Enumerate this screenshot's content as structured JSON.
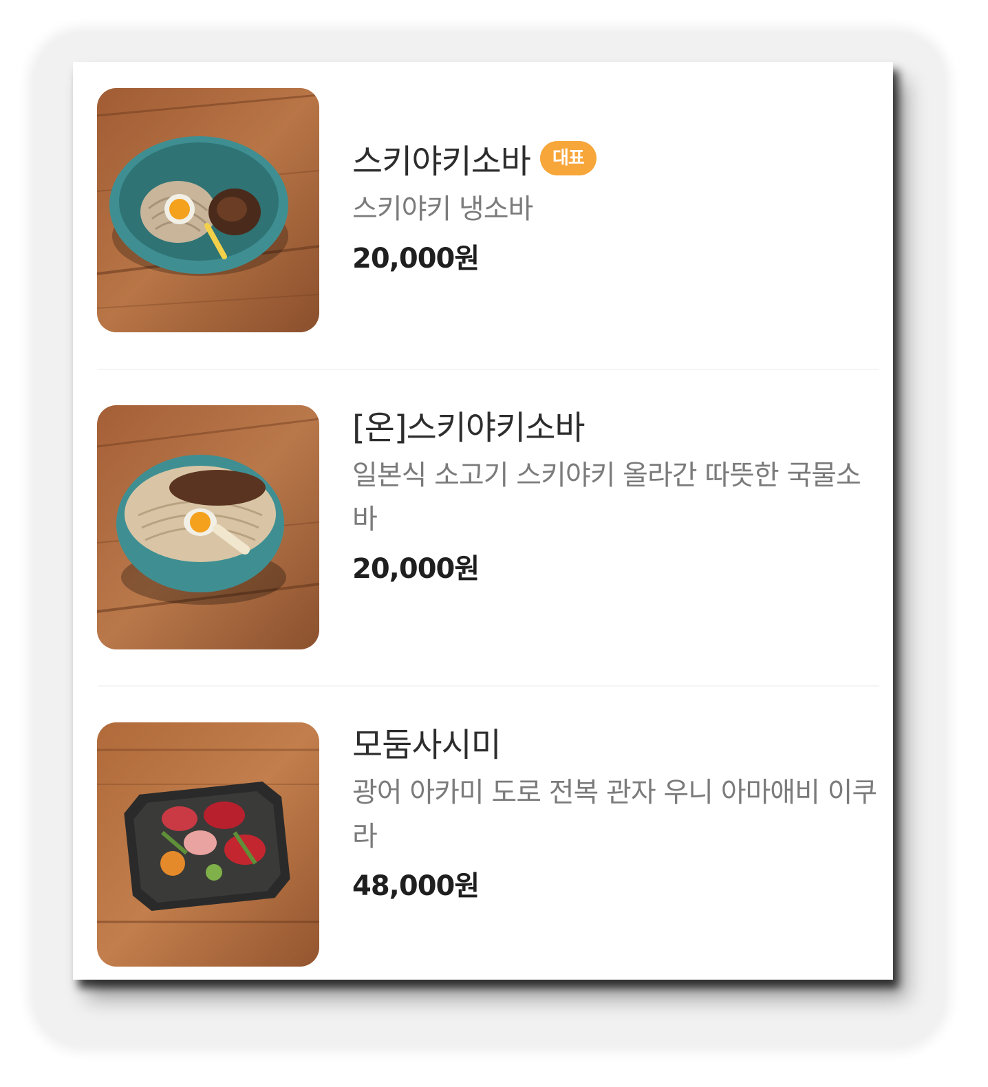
{
  "menu": {
    "items": [
      {
        "name": "스키야키소바",
        "badge": "대표",
        "description": "스키야키 냉소바",
        "price": "20,000원",
        "image": "sukiyaki-cold-soba-photo"
      },
      {
        "name": "[온]스키야키소바",
        "description": "일본식 소고기 스키야키 올라간 따뜻한 국물소바",
        "price": "20,000원",
        "image": "sukiyaki-hot-soba-photo"
      },
      {
        "name": "모둠사시미",
        "description": "광어 아카미 도로 전복 관자 우니 아마애비 이쿠라",
        "price": "48,000원",
        "image": "assorted-sashimi-photo"
      }
    ]
  },
  "colors": {
    "badge": "#f7a63a",
    "bowl": "#3f8f92",
    "wood": "#a8663a"
  }
}
